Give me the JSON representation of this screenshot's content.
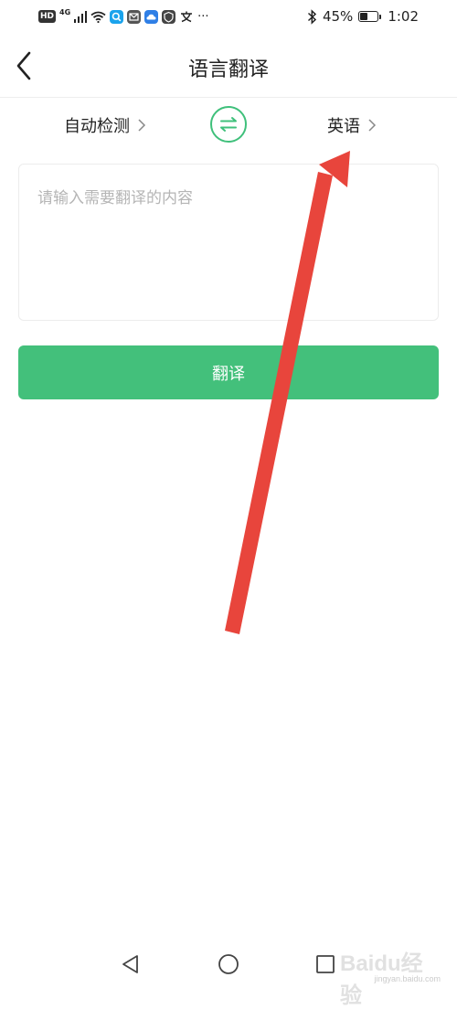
{
  "status_bar": {
    "hd": "HD",
    "network": "4G",
    "extra": "···",
    "battery_percent_text": "45%",
    "battery_level": 0.45,
    "time": "1:02"
  },
  "header": {
    "title": "语言翻译"
  },
  "languages": {
    "source": "自动检测",
    "target": "英语"
  },
  "input": {
    "placeholder": "请输入需要翻译的内容",
    "value": ""
  },
  "translate_button": {
    "label": "翻译"
  },
  "watermark": {
    "text": "Baidu经验",
    "sub": "jingyan.baidu.com"
  },
  "colors": {
    "accent": "#43c07b",
    "annotation_arrow": "#e8453c"
  },
  "icons": {
    "back": "back-chevron-icon",
    "swap": "swap-arrows-icon",
    "chevron": "chevron-right-icon",
    "nav_back": "triangle-back-icon",
    "nav_home": "circle-home-icon",
    "nav_recent": "square-recent-icon"
  }
}
